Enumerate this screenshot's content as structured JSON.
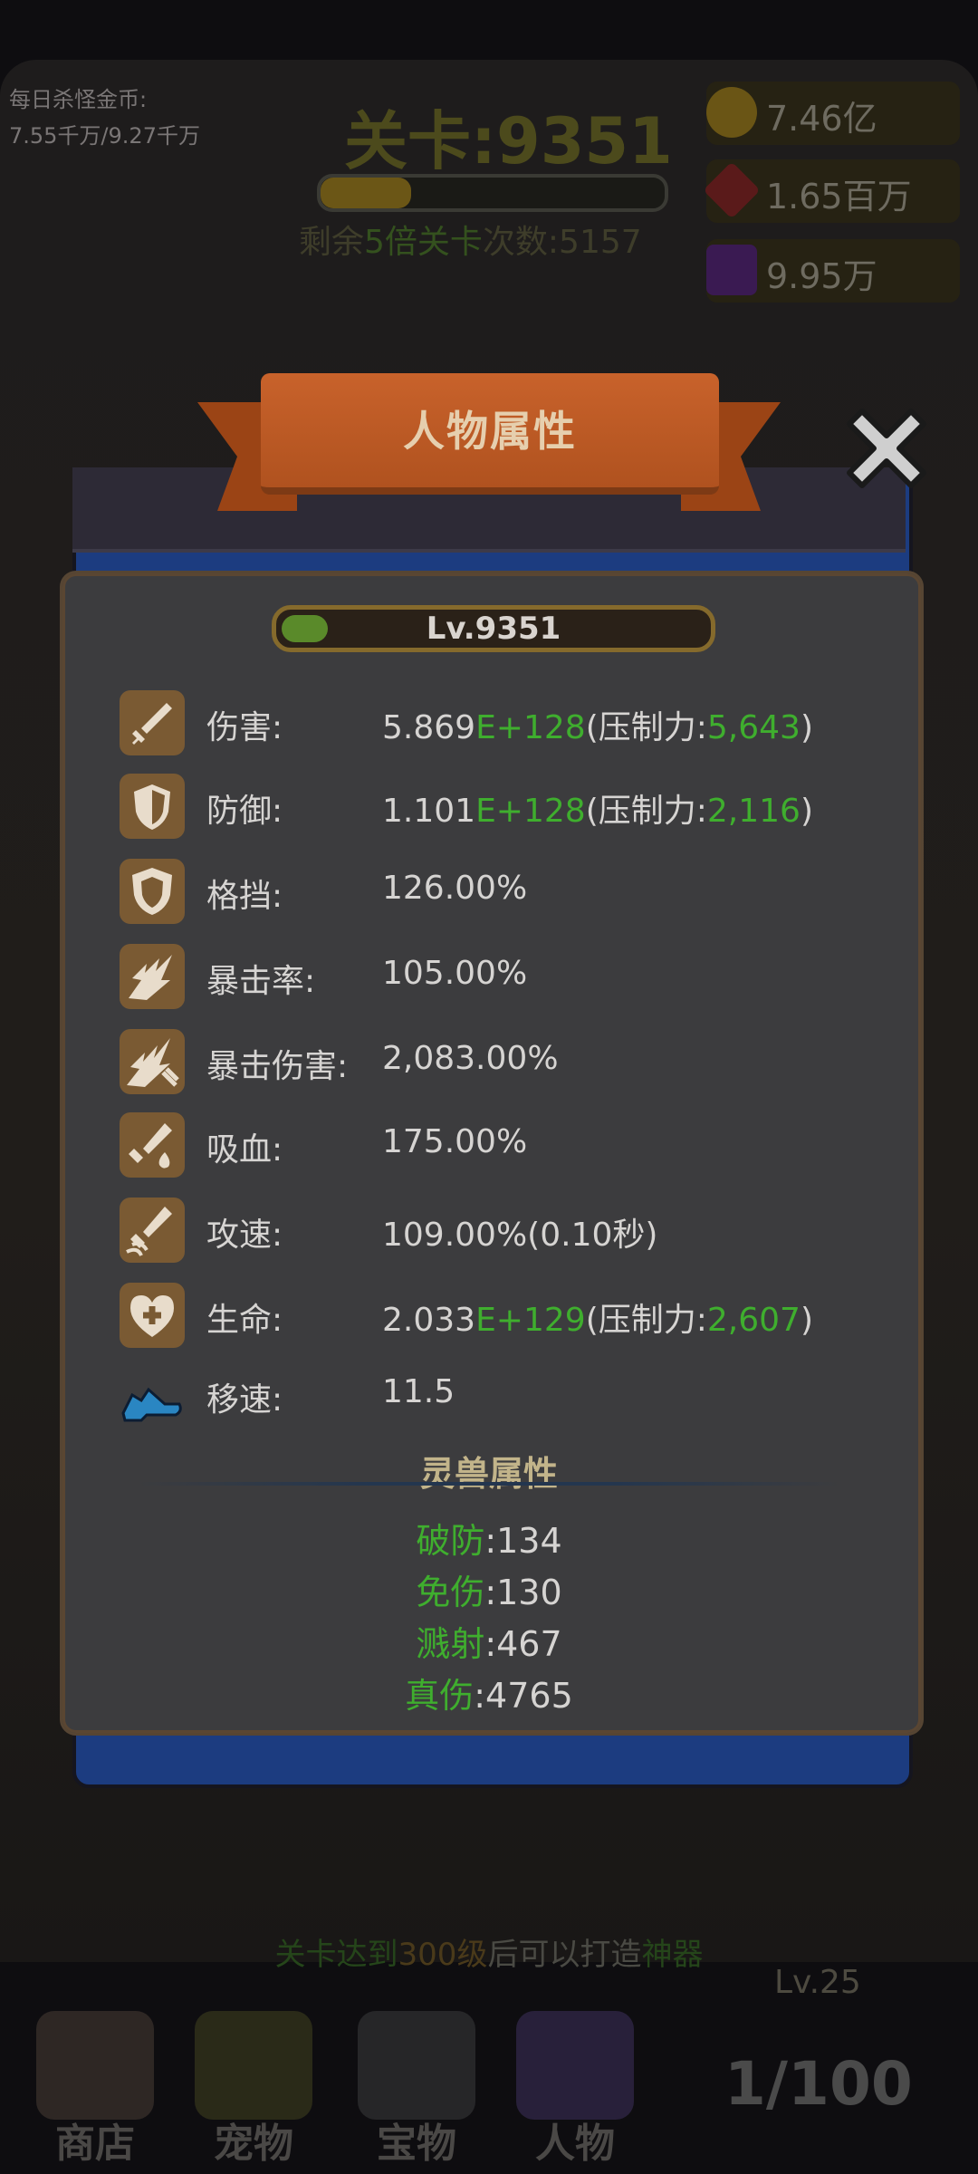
{
  "hud": {
    "daily_label": "每日杀怪金币:",
    "daily_value": "7.55千万/9.27千万",
    "stage_title": "关卡:9351",
    "remain_prefix": "剩余",
    "remain_highlight": "5倍关卡",
    "remain_suffix": "次数:5157",
    "currencies": [
      {
        "icon": "gold-coin-icon",
        "value": "7.46亿"
      },
      {
        "icon": "red-gem-icon",
        "value": "1.65百万"
      },
      {
        "icon": "purple-gem-icon",
        "value": "9.95万"
      }
    ]
  },
  "modal": {
    "title": "人物属性",
    "level": "Lv.9351",
    "level_progress": 0.11,
    "stats": [
      {
        "icon": "sword-icon",
        "label": "伤害:",
        "base": "5.869",
        "exp": "E+128",
        "pre": "(压制力:",
        "supp": "5,643",
        "post": ")"
      },
      {
        "icon": "shield-icon",
        "label": "防御:",
        "base": "1.101",
        "exp": "E+128",
        "pre": "(压制力:",
        "supp": "2,116",
        "post": ")"
      },
      {
        "icon": "block-shield-icon",
        "label": "格挡:",
        "base": "126.00%"
      },
      {
        "icon": "crit-burst-icon",
        "label": "暴击率:",
        "base": "105.00%"
      },
      {
        "icon": "crit-damage-icon",
        "label": "暴击伤害:",
        "base": "2,083.00%"
      },
      {
        "icon": "lifesteal-icon",
        "label": "吸血:",
        "base": "175.00%"
      },
      {
        "icon": "attack-speed-icon",
        "label": "攻速:",
        "base": "109.00%(0.10秒)"
      },
      {
        "icon": "heart-plus-icon",
        "label": "生命:",
        "base": "2.033",
        "exp": "E+129",
        "pre": "(压制力:",
        "supp": "2,607",
        "post": ")"
      },
      {
        "icon": "boot-icon",
        "label": "移速:",
        "base": "11.5"
      }
    ],
    "pet_title": "灵兽属性",
    "pet_stats": [
      {
        "name": "破防",
        "value": ":134"
      },
      {
        "name": "免伤",
        "value": ":130"
      },
      {
        "name": "溅射",
        "value": ":467"
      },
      {
        "name": "真伤",
        "value": ":4765"
      }
    ]
  },
  "bottom": {
    "hint_pre": "关卡达到",
    "hint_num": "300级",
    "hint_mid": "后可以打造",
    "hint_item": "神器",
    "nav": [
      "商店",
      "宠物",
      "宝物",
      "人物"
    ],
    "chest_level": "Lv.25",
    "chest_count": "1/100"
  },
  "colors": {
    "highlight_green": "#3fae2e",
    "ribbon": "#c8622b",
    "panel": "#3c3c3e",
    "icon_bg": "#7a5a33"
  }
}
